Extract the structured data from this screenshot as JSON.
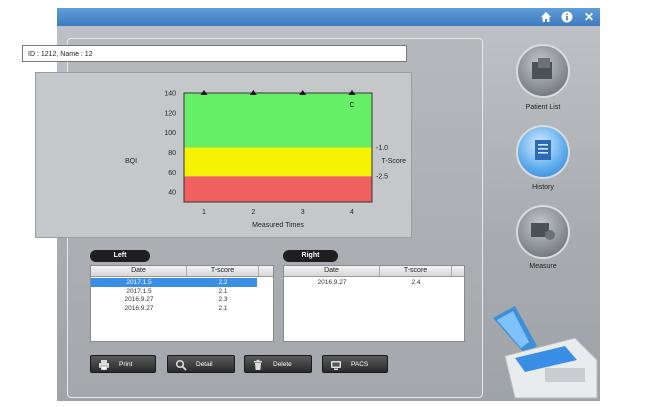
{
  "window": {
    "icons": [
      "home-icon",
      "info-icon",
      "close-icon"
    ],
    "close_glyph": "✕"
  },
  "patient": {
    "id_label": "ID : 1212, Name : 12"
  },
  "chart_data": {
    "type": "area",
    "x_ticks": [
      "1",
      "2",
      "3",
      "4"
    ],
    "xlabel": "Measured Times",
    "ylabel": "BQI",
    "y_ticks": [
      "140",
      "120",
      "100",
      "80",
      "60",
      "40"
    ],
    "ylim": [
      30,
      140
    ],
    "right_label": "T-Score",
    "right_ticks": [
      "-1.0",
      "-2.5"
    ],
    "bands": [
      {
        "from": 30,
        "to": 56,
        "color": "#f06060"
      },
      {
        "from": 56,
        "to": 85,
        "color": "#f5f200"
      },
      {
        "from": 85,
        "to": 140,
        "color": "#66ef66"
      }
    ],
    "markers": [
      {
        "x": 1,
        "label": ""
      },
      {
        "x": 2,
        "label": ""
      },
      {
        "x": 3,
        "label": ""
      },
      {
        "x": 4,
        "label": "C"
      }
    ]
  },
  "left": {
    "title": "Left",
    "headers": [
      "Date",
      "T-score"
    ],
    "rows": [
      {
        "date": "2017.1.5",
        "tscore": "2.2",
        "selected": true
      },
      {
        "date": "2017.1.5",
        "tscore": "2.1",
        "selected": false
      },
      {
        "date": "2016.9.27",
        "tscore": "2.3",
        "selected": false
      },
      {
        "date": "2016.9.27",
        "tscore": "2.1",
        "selected": false
      }
    ]
  },
  "right": {
    "title": "Right",
    "headers": [
      "Date",
      "T-score"
    ],
    "rows": [
      {
        "date": "2016.9.27",
        "tscore": "2.4",
        "selected": false
      }
    ]
  },
  "buttons": {
    "print": "Print",
    "detail": "Detail",
    "delete": "Delete",
    "pacs": "PACS"
  },
  "sidebar": {
    "patient_list": "Patient List",
    "history": "History",
    "measure": "Measure"
  }
}
